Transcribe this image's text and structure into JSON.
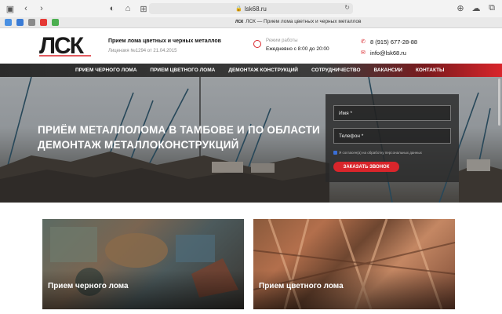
{
  "browser": {
    "address": "lsk68.ru",
    "tab_title": "ЛСК — Прием лома цветных и черных металлов",
    "tab_favicon": "ЛСК"
  },
  "header": {
    "logo_text": "ЛСК",
    "company_name": "Прием лома цветных и черных металлов",
    "license": "Лицензия №1294 от 21.04.2015",
    "hours_label": "Режим работы",
    "hours_value": "Ежедневно с 8:00 до 20:00",
    "phone": "8 (915) 677-28-88",
    "email": "info@lsk68.ru"
  },
  "nav": {
    "items": [
      "ПРИЕМ ЧЕРНОГО ЛОМА",
      "ПРИЕМ ЦВЕТНОГО ЛОМА",
      "ДЕМОНТАЖ КОНСТРУКЦИЙ",
      "СОТРУДНИЧЕСТВО",
      "ВАКАНСИИ",
      "КОНТАКТЫ"
    ]
  },
  "hero": {
    "title_line1": "ПРИЁМ МЕТАЛЛОЛОМА В ТАМБОВЕ И ПО ОБЛАСТИ",
    "title_line2": "ДЕМОНТАЖ МЕТАЛЛОКОНСТРУКЦИЙ"
  },
  "form": {
    "name_placeholder": "Имя *",
    "phone_placeholder": "Телефон *",
    "consent": "Я согласен(а) на обработку персональных данных",
    "submit": "ЗАКАЗАТЬ ЗВОНОК"
  },
  "cards": {
    "left": "Прием черного лома",
    "right": "Прием цветного лома"
  },
  "colors": {
    "accent": "#d9252b",
    "nav_dark": "#2b2b2b"
  },
  "icons": [
    "sidebar-icon",
    "back-icon",
    "forward-icon",
    "shield-icon",
    "home-icon",
    "grid-icon",
    "plus-icon",
    "lock-icon",
    "reload-icon",
    "download-icon",
    "cloud-icon",
    "tabs-icon",
    "clock-icon",
    "phone-icon",
    "mail-icon"
  ]
}
